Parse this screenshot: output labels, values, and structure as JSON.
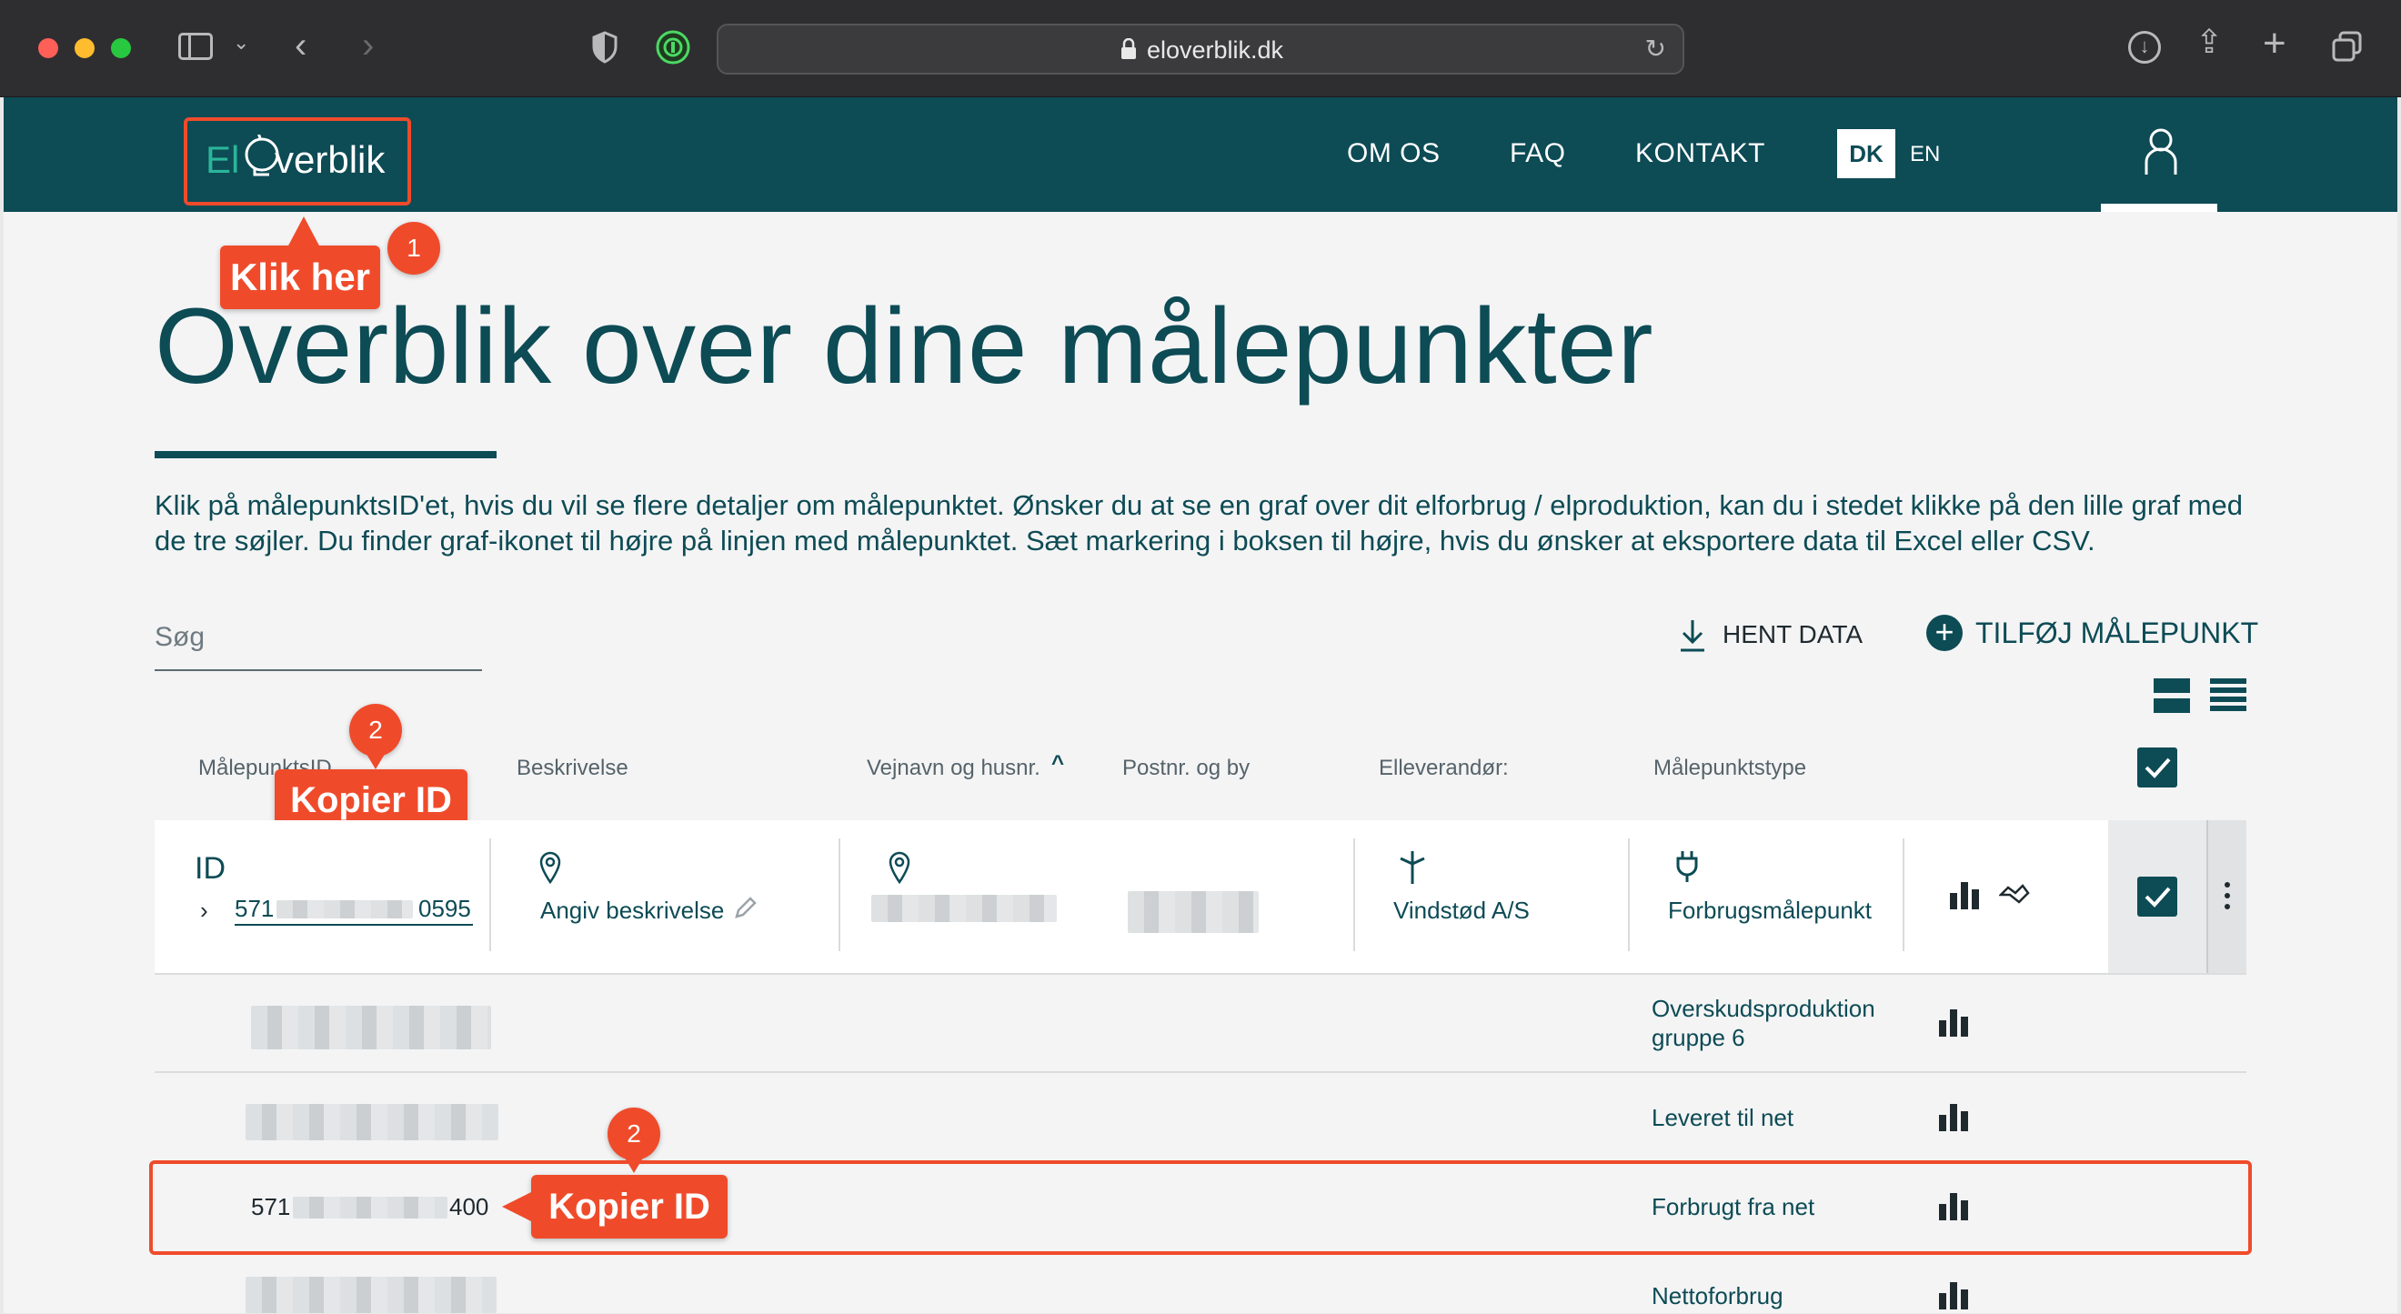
{
  "browser": {
    "url": "eloverblik.dk"
  },
  "app": {
    "logo_text_a": "El",
    "logo_text_b": "verblik",
    "nav": {
      "om_os": "OM OS",
      "faq": "FAQ",
      "kontakt": "KONTAKT",
      "lang_dk": "DK",
      "lang_en": "EN"
    }
  },
  "page": {
    "title": "Overblik over dine målepunkter",
    "intro": "Klik på målepunktsID'et, hvis du vil se flere detaljer om målepunktet. Ønsker du at se en graf over dit elforbrug / elproduktion, kan du i stedet klikke på den lille graf med de tre søjler. Du finder graf-ikonet til højre på linjen med målepunktet. Sæt markering i boksen til højre, hvis du ønsker at eksportere data til Excel eller CSV.",
    "search_placeholder": "Søg",
    "hent_data": "HENT DATA",
    "tilfoej": "TILFØJ MÅLEPUNKT"
  },
  "table": {
    "headers": {
      "id": "MålepunktsID",
      "beskrivelse": "Beskrivelse",
      "vejnavn": "Vejnavn og husnr.",
      "postnr": "Postnr. og by",
      "elleverandor": "Elleverandør:",
      "type": "Målepunktstype"
    },
    "main_row": {
      "id_label": "ID",
      "id_prefix": "571",
      "id_suffix": "0595",
      "beskrivelse": "Angiv beskrivelse",
      "elleverandor": "Vindstød A/S",
      "type": "Forbrugsmålepunkt"
    },
    "sub_rows": [
      {
        "type_line1": "Overskudsproduktion",
        "type_line2": "gruppe 6"
      },
      {
        "type": "Leveret til net"
      },
      {
        "id_prefix": "571",
        "id_suffix": "400",
        "type": "Forbrugt fra net"
      },
      {
        "type": "Nettoforbrug"
      }
    ]
  },
  "annotations": {
    "step1_label": "Klik her",
    "step1_num": "1",
    "step2_label_a": "Kopier ID",
    "step2_num_a": "2",
    "step2_label_b": "Kopier ID",
    "step2_num_b": "2"
  },
  "colors": {
    "brand": "#0d4b55",
    "annotation": "#ef4b2b",
    "accent_green": "#2bb59a"
  }
}
